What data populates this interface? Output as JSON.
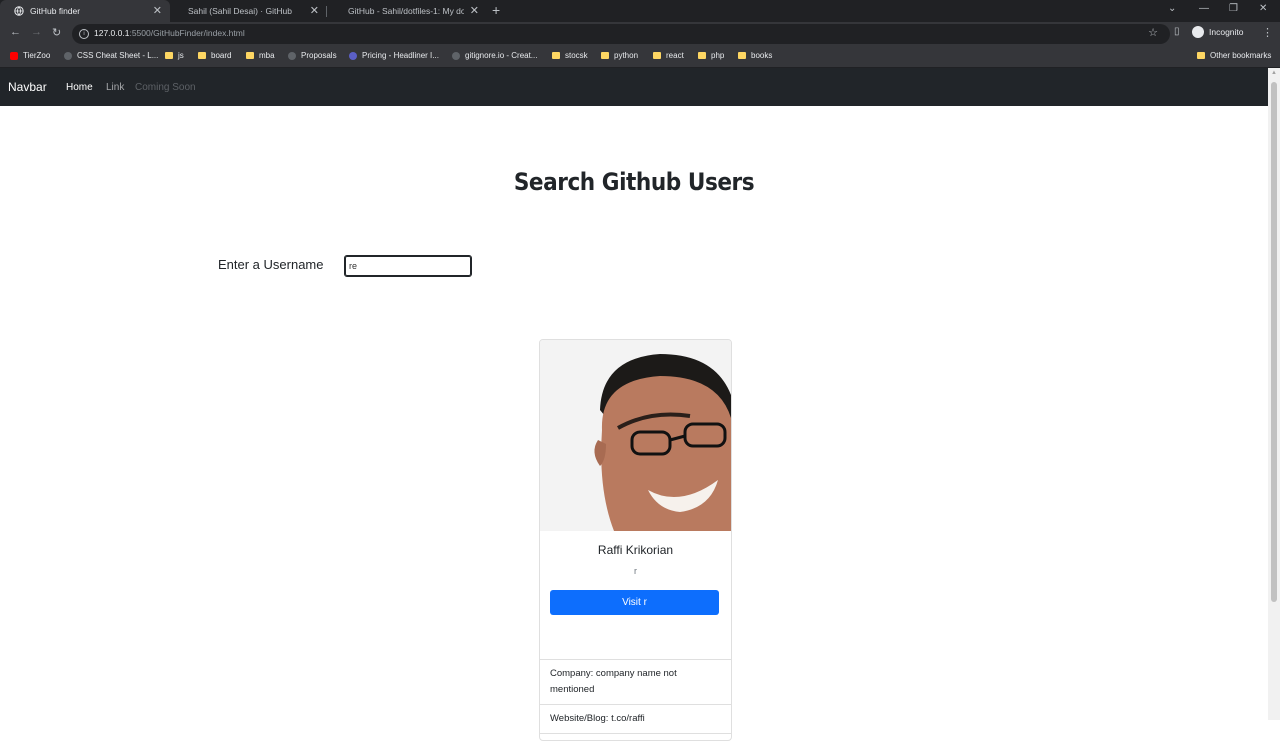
{
  "browser": {
    "tabs": [
      {
        "title": "GitHub finder",
        "active": true
      },
      {
        "title": "Sahil (Sahil Desai) · GitHub",
        "active": false
      },
      {
        "title": "GitHub - Sahil/dotfiles-1: My dot",
        "active": false
      }
    ],
    "url_host": "127.0.0.1",
    "url_path": ":5500/GitHubFinder/index.html",
    "profile_label": "Incognito",
    "bookmarks": [
      "TierZoo",
      "CSS Cheat Sheet - L...",
      "js",
      "board",
      "mba",
      "Proposals",
      "Pricing - Headliner I...",
      "gitignore.io - Creat...",
      "stocsk",
      "python",
      "react",
      "php",
      "books"
    ],
    "other_bookmarks": "Other bookmarks"
  },
  "navbar": {
    "brand": "Navbar",
    "links": [
      "Home",
      "Link",
      "Coming Soon"
    ]
  },
  "page": {
    "title": "Search Github Users",
    "username_label": "Enter a Username",
    "username_value": "re"
  },
  "card": {
    "name": "Raffi Krikorian",
    "login": "r",
    "button_label": "Visit r",
    "company": "Company: company name not mentioned",
    "website": "Website/Blog: t.co/raffi"
  },
  "colors": {
    "navbar_bg": "#212529",
    "primary": "#0d6efd"
  }
}
